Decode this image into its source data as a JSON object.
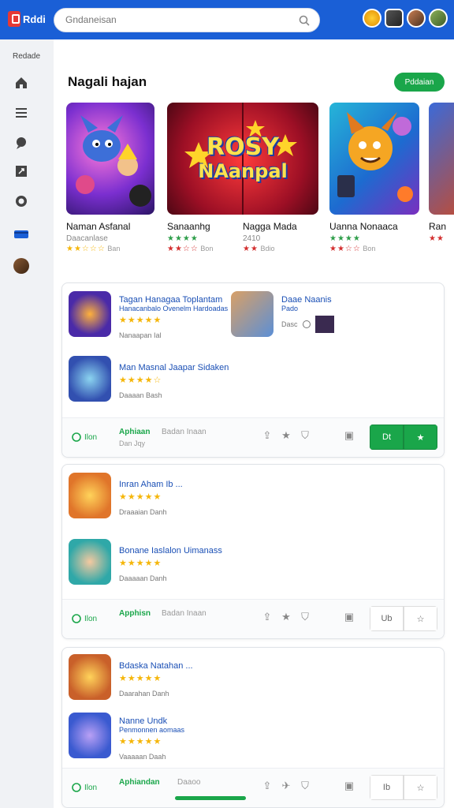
{
  "app": {
    "logo_text": "Rddi"
  },
  "search": {
    "placeholder": "Gndaneisan"
  },
  "sidebar": {
    "label": "Redade"
  },
  "featured_section": {
    "title": "Nagali hajan",
    "button_label": "Pddaian",
    "center_art_lines": [
      "ROSY",
      "NAanpal"
    ],
    "cards": [
      {
        "name": "Naman Asfanal",
        "sub": "Daacanlase",
        "stars": "★★☆☆☆",
        "meta": "Ban"
      },
      {
        "name": "Sanaanhg",
        "sub": "★★★★",
        "stars": "★★☆☆",
        "meta": "Bon"
      },
      {
        "name": "Nagga Mada",
        "sub": "2410",
        "stars": "★★",
        "meta": "Bdio"
      },
      {
        "name": "Uanna Nonaaca",
        "sub": "★★★★",
        "stars": "★★☆☆",
        "meta": "Bon"
      },
      {
        "name": "Ran",
        "sub": "",
        "stars": "★★",
        "meta": ""
      }
    ]
  },
  "cards": [
    {
      "apps": [
        {
          "title": "Tagan Hanagaa Toplantam",
          "subtitle": "Hanacanbalo Ovenelm Hardoadas",
          "stars": "★★★★★",
          "meta": "Nanaapan  Ial"
        },
        {
          "title": "Daae Naanis",
          "subtitle": "Pado",
          "stars": "",
          "meta": "Dasc"
        },
        {
          "title": "Man Masnal Jaapar Sidaken",
          "subtitle": "",
          "stars": "★★★★☆",
          "meta": "Daaaan  Bash"
        }
      ],
      "footer": {
        "new": "Ilon",
        "app": "Aphiaan",
        "app2": "Badan Inaan",
        "sub": "Dan Jqy",
        "btn1": "Dt",
        "btn2": "★"
      }
    },
    {
      "apps": [
        {
          "title": "Inran Aham Ib  ...",
          "subtitle": "",
          "stars": "★★★★★",
          "meta": "Draaaian  Danh"
        },
        {
          "title": "Bonane Iaslalon Uimanass",
          "subtitle": "",
          "stars": "★★★★★",
          "meta": "Daaaaan  Danh"
        }
      ],
      "footer": {
        "new": "Ilon",
        "app": "Apphisn",
        "app2": "Badan Inaan",
        "sub": "",
        "btn1": "Ub",
        "btn2": "☆"
      }
    },
    {
      "apps": [
        {
          "title": "Bdaska Natahan  ...",
          "subtitle": "",
          "stars": "★★★★★",
          "meta": "Daarahan  Danh"
        },
        {
          "title": "Nanne Undk",
          "subtitle": "Penmonnen aomaas",
          "stars": "★★★★★",
          "meta": "Vaaaaan  Daah"
        }
      ],
      "footer": {
        "new": "Ilon",
        "app": "Aphiandan",
        "app2": "Daaoo",
        "sub": "",
        "btn1": "Ib",
        "btn2": "☆"
      }
    }
  ],
  "colors": {
    "topbar": "#1a5fd6",
    "accent_green": "#1aa64a",
    "link_blue": "#1a4fb5",
    "star_gold": "#f5b60a"
  }
}
